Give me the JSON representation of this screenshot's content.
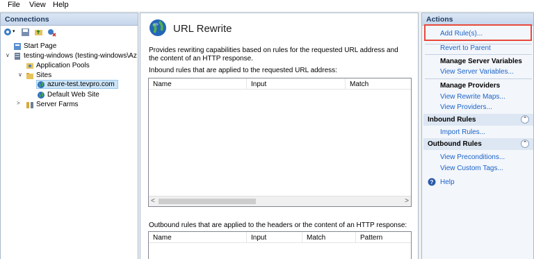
{
  "menu": [
    "File",
    "View",
    "Help"
  ],
  "connections": {
    "title": "Connections",
    "tree": {
      "start_page": "Start Page",
      "server": "testing-windows (testing-windows\\Az",
      "app_pools": "Application Pools",
      "sites": "Sites",
      "site1": "azure-test.tevpro.com",
      "site2": "Default Web Site",
      "server_farms": "Server Farms"
    }
  },
  "main": {
    "title": "URL Rewrite",
    "description": "Provides rewriting capabilities based on rules for the requested URL address and the content of an HTTP response.",
    "inbound_label": "Inbound rules that are applied to the requested URL address:",
    "inbound_columns": [
      "Name",
      "Input",
      "Match"
    ],
    "outbound_label": "Outbound rules that are applied to the headers or the content of an HTTP response:",
    "outbound_columns": [
      "Name",
      "Input",
      "Match",
      "Pattern"
    ]
  },
  "actions": {
    "title": "Actions",
    "add_rules": "Add Rule(s)...",
    "revert_parent": "Revert to Parent",
    "manage_server_vars": "Manage Server Variables",
    "view_server_vars": "View Server Variables...",
    "manage_providers": "Manage Providers",
    "view_rewrite_maps": "View Rewrite Maps...",
    "view_providers": "View Providers...",
    "inbound_rules": "Inbound Rules",
    "import_rules": "Import Rules...",
    "outbound_rules": "Outbound Rules",
    "view_preconditions": "View Preconditions...",
    "view_custom_tags": "View Custom Tags...",
    "help": "Help"
  },
  "colors": {
    "link": "#1a63c8",
    "highlight": "#e8493b"
  }
}
